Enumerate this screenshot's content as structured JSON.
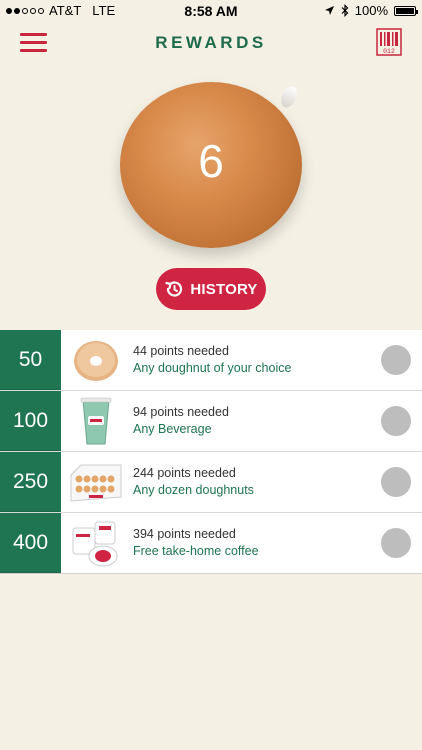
{
  "status_bar": {
    "carrier": "AT&T",
    "network": "LTE",
    "time": "8:58 AM",
    "battery": "100%"
  },
  "header": {
    "title": "REWARDS",
    "barcode_digits": "012"
  },
  "points": {
    "value": "6"
  },
  "history_button": {
    "label": "HISTORY"
  },
  "rewards": [
    {
      "tier": "50",
      "points_needed": "44 points needed",
      "name": "Any doughnut of your choice",
      "icon": "doughnut-icon"
    },
    {
      "tier": "100",
      "points_needed": "94 points needed",
      "name": "Any Beverage",
      "icon": "beverage-cup-icon"
    },
    {
      "tier": "250",
      "points_needed": "244 points needed",
      "name": "Any dozen doughnuts",
      "icon": "dozen-box-icon"
    },
    {
      "tier": "400",
      "points_needed": "394 points needed",
      "name": "Free take-home coffee",
      "icon": "coffee-pods-icon"
    }
  ],
  "colors": {
    "background": "#f4f0e4",
    "brand_green": "#1f7552",
    "brand_red": "#cf2543",
    "circle_gray": "#bdbdbd"
  }
}
